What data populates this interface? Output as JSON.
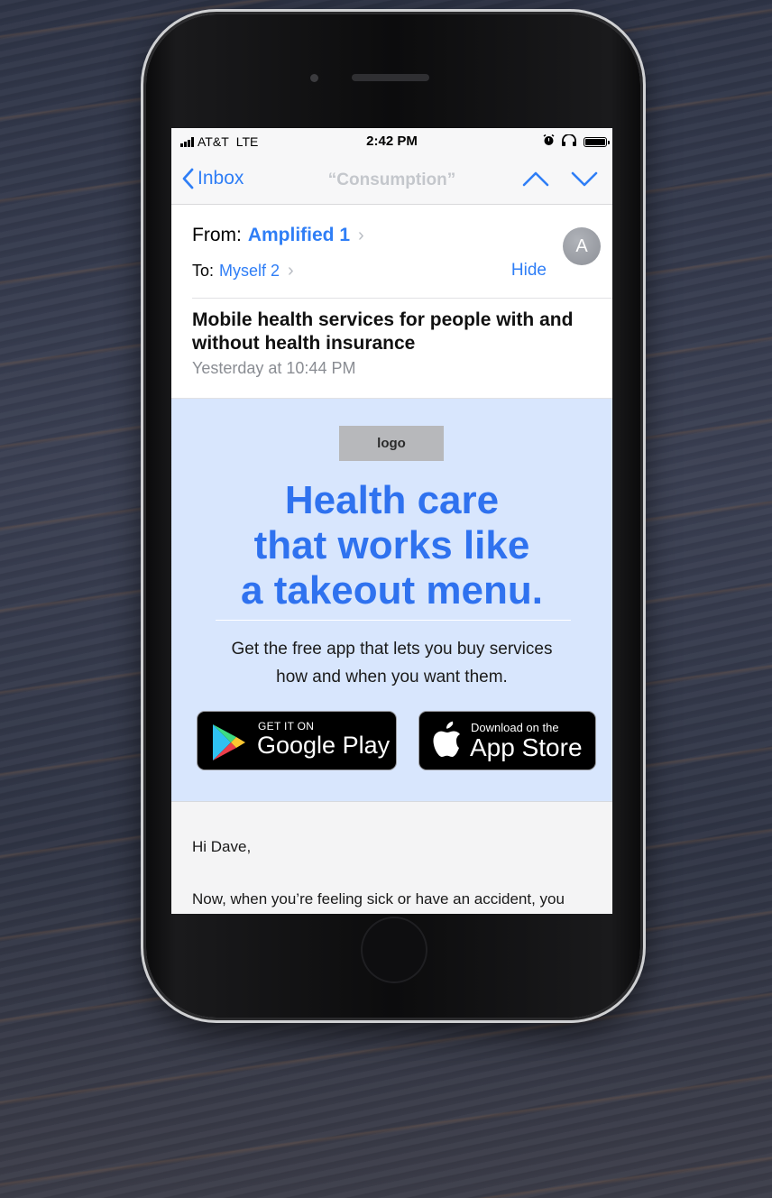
{
  "status": {
    "carrier": "AT&T",
    "network": "LTE",
    "time": "2:42 PM"
  },
  "nav": {
    "back_label": "Inbox",
    "title": "“Consumption”"
  },
  "header": {
    "from_label": "From:",
    "from_name": "Amplified 1",
    "to_label": "To:",
    "to_name": "Myself 2",
    "hide_label": "Hide",
    "avatar_initial": "A",
    "subject": "Mobile health services for people with and without health insurance",
    "date": "Yesterday at 10:44 PM"
  },
  "hero": {
    "logo_text": "logo",
    "headline": [
      "Health care",
      "that works like",
      "a takeout menu."
    ],
    "subtext_line1": "Get the free app that lets you buy services",
    "subtext_line2": "how and when you want them.",
    "google_small": "GET IT ON",
    "google_big": "Google Play",
    "apple_small": "Download on the",
    "apple_big": "App Store"
  },
  "body": {
    "greeting": "Hi Dave,",
    "paragraph_start": "Now, when you’re feeling sick or have an accident, you"
  },
  "colors": {
    "accent": "#2f7ef6",
    "headline": "#2f72ef",
    "hero_bg": "#d8e6fd"
  }
}
